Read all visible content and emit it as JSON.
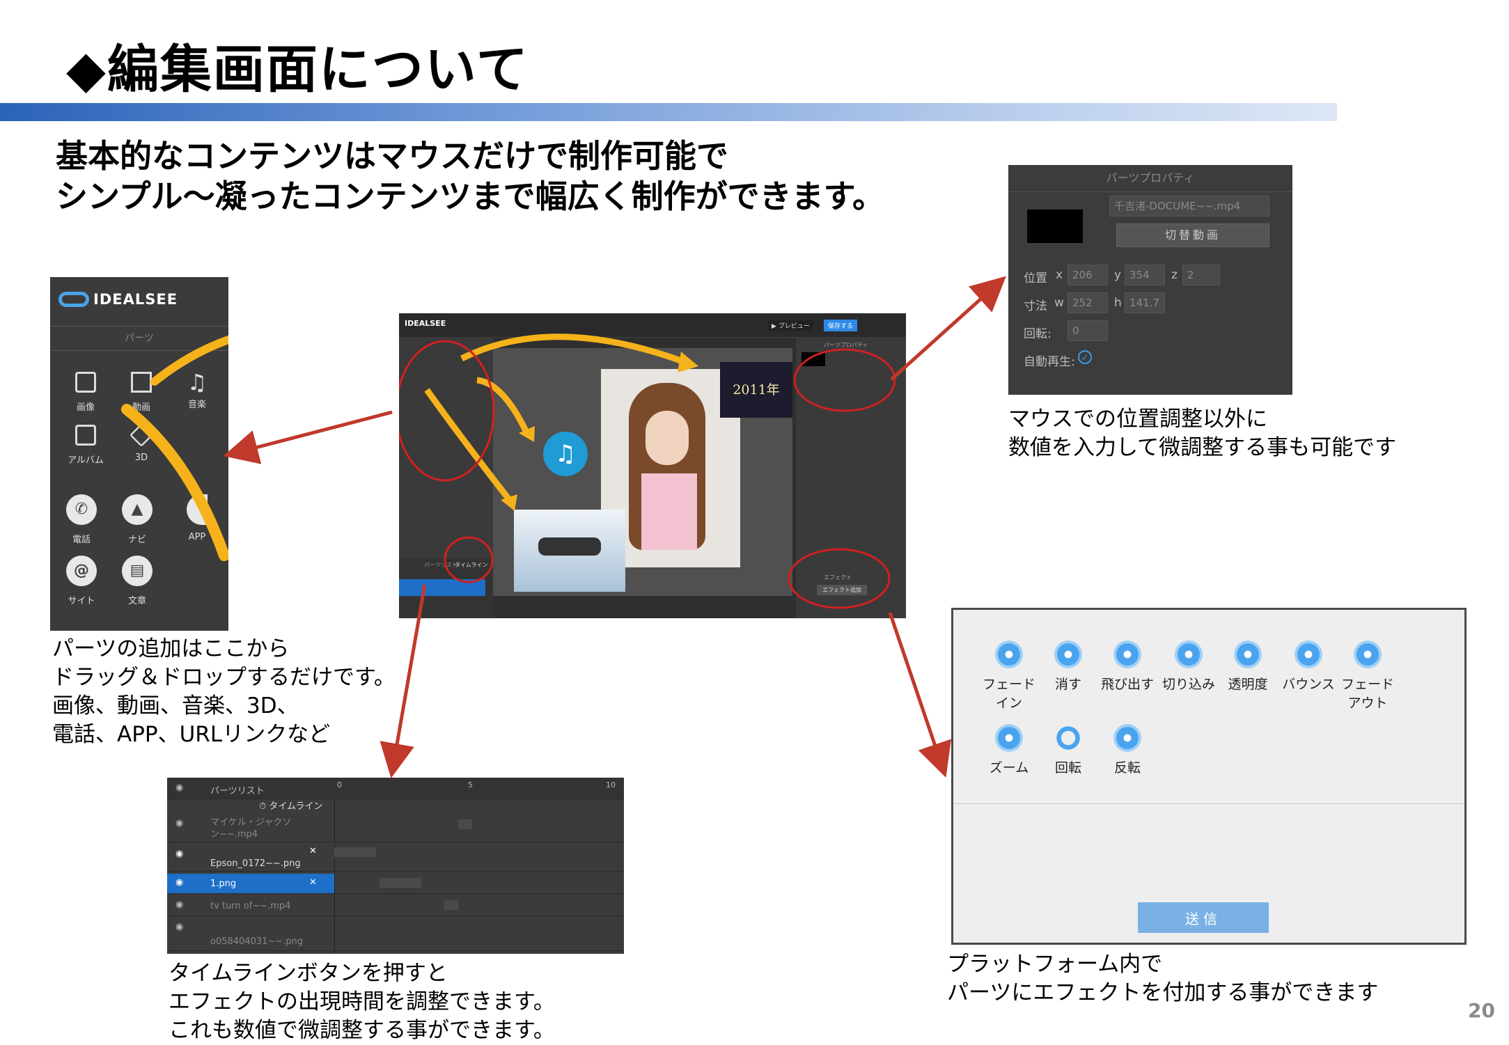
{
  "title": "◆編集画面について",
  "lead": {
    "line1": "基本的なコンテンツはマウスだけで制作可能で",
    "line2": "シンプル～凝ったコンテンツまで幅広く制作ができます。"
  },
  "parts_panel": {
    "logo_text": "IDEALSEE",
    "header": "パーツ",
    "items": [
      {
        "label": "画像",
        "icon": "image-icon"
      },
      {
        "label": "動画",
        "icon": "film-icon"
      },
      {
        "label": "音楽",
        "icon": "music-note-icon"
      },
      {
        "label": "アルバム",
        "icon": "album-icon"
      },
      {
        "label": "3D",
        "icon": "cube-icon"
      },
      {
        "label": "電話",
        "icon": "phone-icon"
      },
      {
        "label": "ナビ",
        "icon": "navigation-icon"
      },
      {
        "label": "APP",
        "icon": "app-icon"
      },
      {
        "label": "サイト",
        "icon": "at-sign-icon"
      },
      {
        "label": "文章",
        "icon": "document-icon"
      }
    ]
  },
  "caption_parts": [
    "パーツの追加はここから",
    "ドラッグ＆ドロップするだけです。",
    "画像、動画、音楽、3D、",
    "電話、APP、URLリンクなど"
  ],
  "property_panel": {
    "header": "パーツプロパティ",
    "filename": "千吉渚-DOCUME~~.mp4",
    "switch_button": "切替動画",
    "position_label": "位置",
    "x_label": "x",
    "x_value": "206",
    "y_label": "y",
    "y_value": "354",
    "z_label": "z",
    "z_value": "2",
    "size_label": "寸法",
    "w_label": "w",
    "w_value": "252",
    "h_label": "h",
    "h_value": "141.7",
    "rotation_label": "回転:",
    "rotation_value": "0",
    "autoplay_label": "自動再生:"
  },
  "caption_props": [
    "マウスでの位置調整以外に",
    "数値を入力して微調整する事も可能です"
  ],
  "timeline_panel": {
    "parts_list_header": "パーツリスト",
    "timeline_button": "タイムライン",
    "ruler": [
      "0",
      "5",
      "10"
    ],
    "rows": [
      {
        "name": "マイケル・ジャクソン~~.mp4",
        "selected": false
      },
      {
        "name": "Epson_0172~~.png",
        "selected": false
      },
      {
        "name": "1.png",
        "selected": true
      },
      {
        "name": "tv turn of~~.mp4",
        "selected": false
      },
      {
        "name": "o058404031~~.png",
        "selected": false
      }
    ]
  },
  "caption_timeline": [
    "タイムラインボタンを押すと",
    "エフェクトの出現時間を調整できます。",
    "これも数値で微調整する事ができます。"
  ],
  "effects_panel": {
    "effects": [
      "フェードイン",
      "消す",
      "飛び出す",
      "切り込み",
      "透明度",
      "バウンス",
      "フェードアウト",
      "ズーム",
      "回転",
      "反転"
    ],
    "send_button": "送信"
  },
  "caption_effects": [
    "プラットフォーム内で",
    "パーツにエフェクトを付加する事ができます"
  ],
  "editor": {
    "logo_text": "IDEALSEE",
    "preview_button": "▶ プレビュー",
    "save_button": "保存する",
    "right_header": "パーツプロパティ",
    "effect_header": "エフェクト",
    "effect_button": "エフェクト追加",
    "video_year": "2011年",
    "parts_list": "パーツリスト",
    "timeline": "タイムライン"
  },
  "page_number": "20",
  "colors": {
    "accent_blue": "#2b63b8",
    "annotation_red": "#c0392b",
    "arrow_yellow": "#f6b21a"
  }
}
